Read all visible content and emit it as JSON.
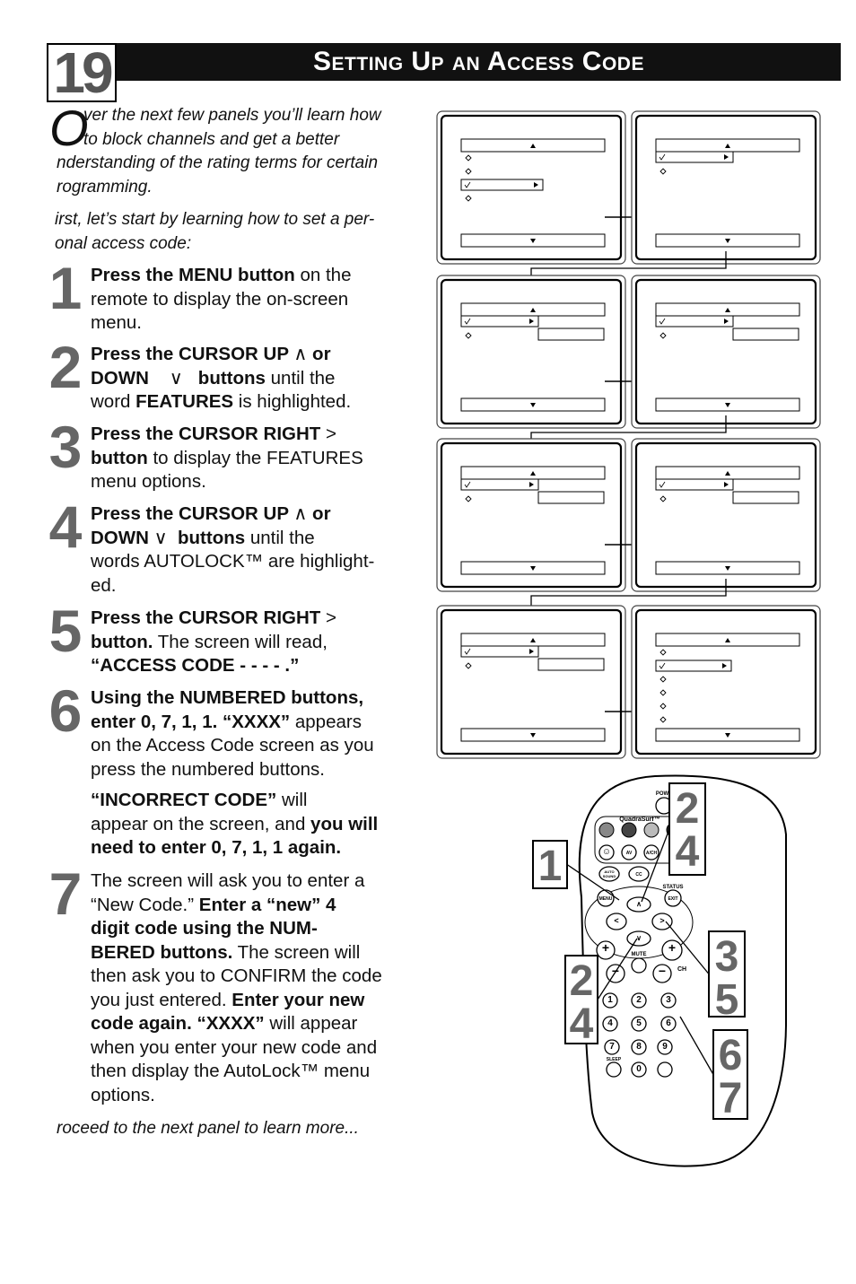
{
  "header": {
    "page_number": "19",
    "title": "Setting Up an Access Code"
  },
  "intro": {
    "drop_cap": "O",
    "lines": [
      "ver the next few panels you’ll learn how",
      "to block channels and get a better",
      "nderstanding of the rating terms for certain",
      "rogramming."
    ],
    "second_paragraph": [
      "irst, let’s start by learning how to set a per-",
      "onal access code:"
    ]
  },
  "steps": [
    {
      "number": "1",
      "lines": [
        [
          {
            "t": "Press the MENU button",
            "b": true
          },
          {
            "t": " on the",
            "b": false
          }
        ],
        [
          {
            "t": "remote to display the on-screen",
            "b": false
          }
        ],
        [
          {
            "t": "menu.",
            "b": false
          }
        ]
      ]
    },
    {
      "number": "2",
      "lines": [
        [
          {
            "t": "Press the CURSOR UP ",
            "b": true
          },
          {
            "t": "∧",
            "b": false
          },
          {
            "t": " or",
            "b": true
          }
        ],
        [
          {
            "t": "DOWN ",
            "b": true
          },
          {
            "t": "   ∨   ",
            "b": false
          },
          {
            "t": "buttons",
            "b": true
          },
          {
            "t": " until the",
            "b": false
          }
        ],
        [
          {
            "t": "word ",
            "b": false
          },
          {
            "t": "FEATURES",
            "b": true
          },
          {
            "t": " is highlighted.",
            "b": false
          }
        ]
      ]
    },
    {
      "number": "3",
      "lines": [
        [
          {
            "t": "Press the CURSOR RIGHT ",
            "b": true
          },
          {
            "t": ">",
            "b": false
          }
        ],
        [
          {
            "t": "button",
            "b": true
          },
          {
            "t": " to display the FEATURES",
            "b": false
          }
        ],
        [
          {
            "t": "menu options.",
            "b": false
          }
        ]
      ]
    },
    {
      "number": "4",
      "lines": [
        [
          {
            "t": "Press the CURSOR UP ",
            "b": true
          },
          {
            "t": "∧",
            "b": false
          },
          {
            "t": " or",
            "b": true
          }
        ],
        [
          {
            "t": "DOWN ",
            "b": true
          },
          {
            "t": "∨  ",
            "b": false
          },
          {
            "t": "buttons",
            "b": true
          },
          {
            "t": " until the",
            "b": false
          }
        ],
        [
          {
            "t": "words AUTOLOCK™ are highlight-",
            "b": false
          }
        ],
        [
          {
            "t": "ed.",
            "b": false
          }
        ]
      ]
    },
    {
      "number": "5",
      "lines": [
        [
          {
            "t": "Press the CURSOR RIGHT ",
            "b": true
          },
          {
            "t": ">",
            "b": false
          }
        ],
        [
          {
            "t": "button.",
            "b": true
          },
          {
            "t": " The screen will read,",
            "b": false
          }
        ],
        [
          {
            "t": "“ACCESS CODE - - - - .”",
            "b": true
          }
        ]
      ]
    },
    {
      "number": "6",
      "lines": [
        [
          {
            "t": "Using the NUMBERED buttons,",
            "b": true
          }
        ],
        [
          {
            "t": "enter 0, 7, 1, 1. “XXXX”",
            "b": true
          },
          {
            "t": " appears",
            "b": false
          }
        ],
        [
          {
            "t": "on the Access Code screen as you",
            "b": false
          }
        ],
        [
          {
            "t": "press the numbered buttons.",
            "b": false
          }
        ],
        [
          {
            "t": "",
            "b": false
          }
        ],
        [
          {
            "t": "“INCORRECT CODE”",
            "b": true
          },
          {
            "t": " will",
            "b": false
          }
        ],
        [
          {
            "t": "appear on the screen, and ",
            "b": false
          },
          {
            "t": "you will",
            "b": true
          }
        ],
        [
          {
            "t": "need to enter 0, 7, 1, 1 again.",
            "b": true
          }
        ]
      ]
    },
    {
      "number": "7",
      "lines": [
        [
          {
            "t": "The screen will ask you to enter a",
            "b": false
          }
        ],
        [
          {
            "t": "“New Code.” ",
            "b": false
          },
          {
            "t": "Enter a “new” 4",
            "b": true
          }
        ],
        [
          {
            "t": "digit code using the NUM-",
            "b": true
          }
        ],
        [
          {
            "t": "BERED buttons.",
            "b": true
          },
          {
            "t": " The screen will",
            "b": false
          }
        ],
        [
          {
            "t": "then ask you to CONFIRM the code",
            "b": false
          }
        ],
        [
          {
            "t": "you just entered. ",
            "b": false
          },
          {
            "t": "Enter your new",
            "b": true
          }
        ],
        [
          {
            "t": "code again. “XXXX”",
            "b": true
          },
          {
            "t": " will appear",
            "b": false
          }
        ],
        [
          {
            "t": "when you enter your new code and",
            "b": false
          }
        ],
        [
          {
            "t": "then display the AutoLock™ menu",
            "b": false
          }
        ],
        [
          {
            "t": "options.",
            "b": false
          }
        ]
      ]
    }
  ],
  "outro": "roceed to the next panel to learn more...",
  "remote": {
    "labels": {
      "power": "POWE",
      "quadrasurf": "QuadraSurf™",
      "av": "AV",
      "ach": "A/CH",
      "auto_sound": [
        "AUTO",
        "SOUND"
      ],
      "cc": "CC",
      "status": "STATUS",
      "menu": "MENU",
      "exit": "EXIT",
      "mute": "MUTE",
      "ch": "CH",
      "sleep": "SLEEP"
    },
    "digits": [
      "1",
      "2",
      "3",
      "4",
      "5",
      "6",
      "7",
      "8",
      "9",
      "0"
    ],
    "callouts": [
      [
        "1"
      ],
      [
        "2",
        "4"
      ],
      [
        "3",
        "5"
      ],
      [
        "2",
        "4"
      ],
      [
        "6",
        "7"
      ]
    ]
  },
  "colors": {
    "step_number": "#666666",
    "title_bar": "#111111",
    "quadrasurf_buttons": [
      "#888888",
      "#444444",
      "#bbbbbb",
      "#222222"
    ]
  }
}
